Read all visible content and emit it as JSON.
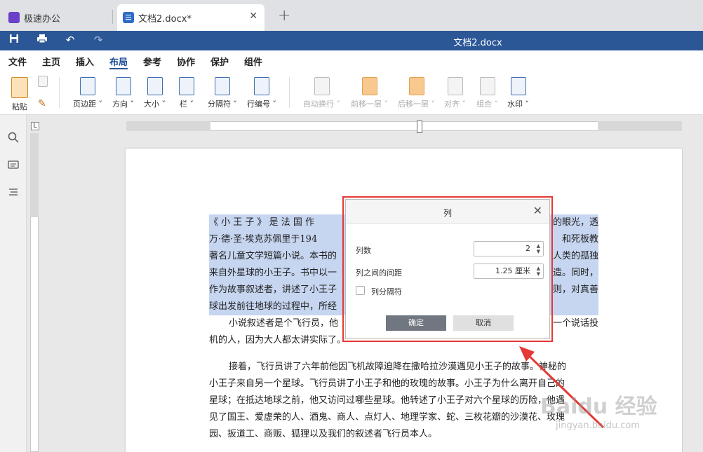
{
  "tabs": {
    "app_label": "极速办公",
    "doc_label": "文档2.docx*",
    "close": "✕",
    "new": "+"
  },
  "titlebar": {
    "title": "文档2.docx",
    "save_icon": "save-icon",
    "print_icon": "print-icon",
    "undo": "↶",
    "redo": "↷"
  },
  "menu": [
    "文件",
    "主页",
    "插入",
    "布局",
    "参考",
    "协作",
    "保护",
    "组件"
  ],
  "ribbon": {
    "paste": "粘贴",
    "tools": [
      {
        "label": "页边距 ˅",
        "icon": "margins-icon"
      },
      {
        "label": "方向 ˅",
        "icon": "orientation-icon"
      },
      {
        "label": "大小 ˅",
        "icon": "size-icon"
      },
      {
        "label": "栏 ˅",
        "icon": "columns-icon"
      },
      {
        "label": "分隔符 ˅",
        "icon": "breaks-icon"
      },
      {
        "label": "行编号 ˅",
        "icon": "line-numbers-icon"
      },
      {
        "label": "自动换行 ˅",
        "icon": "wrap-icon"
      },
      {
        "label": "前移一层 ˅",
        "icon": "bring-forward-icon"
      },
      {
        "label": "后移一层 ˅",
        "icon": "send-backward-icon"
      },
      {
        "label": "对齐 ˅",
        "icon": "align-icon"
      },
      {
        "label": "组合 ˅",
        "icon": "group-icon"
      },
      {
        "label": "水印 ˅",
        "icon": "watermark-icon"
      }
    ]
  },
  "document": {
    "highlighted_lines": [
      "《 小 王 子 》 是 法 国 作",
      "万·德·圣·埃克苏佩里于194",
      "著名儿童文学短篇小说。本书的",
      "来自外星球的小王子。书中以一",
      "作为故事叙述者，讲述了小王子",
      "球出发前往地球的过程中，所经"
    ],
    "highlighted_right": [
      "的眼光，透",
      "和死板教",
      "人类的孤独",
      "造。同时，",
      "则，对真善",
      ""
    ],
    "p2_line1_left": "小说叙述者是个飞行员，他",
    "p2_line1_right": "一个说话投",
    "p2_line2": "机的人，因为大人都太讲实际了。",
    "p3": [
      "接着，飞行员讲了六年前他因飞机故障迫降在撒哈拉沙漠遇见小王子的故事。神秘的",
      "小王子来自另一个星球。飞行员讲了小王子和他的玫瑰的故事。小王子为什么离开自己的",
      "星球；在抵达地球之前，他又访问过哪些星球。他转述了小王子对六个星球的历险，他遇",
      "见了国王、爱虚荣的人、酒鬼、商人、点灯人、地理学家、蛇、三枚花瓣的沙漠花、玫瑰",
      "园、扳道工、商贩、狐狸以及我们的叙述者飞行员本人。"
    ]
  },
  "dialog": {
    "title": "列",
    "close": "✕",
    "columns_label": "列数",
    "columns_value": "2",
    "spacing_label": "列之间的间距",
    "spacing_value": "1.25 厘米",
    "separator_label": "列分隔符",
    "separator_checked": false,
    "ok": "确定",
    "cancel": "取消"
  },
  "watermark": {
    "brand": "Baidu 经验",
    "url": "jingyan.baidu.com"
  },
  "colors": {
    "titlebar": "#2b5797",
    "highlight": "#c6d5f0",
    "annotation": "#e53935"
  }
}
